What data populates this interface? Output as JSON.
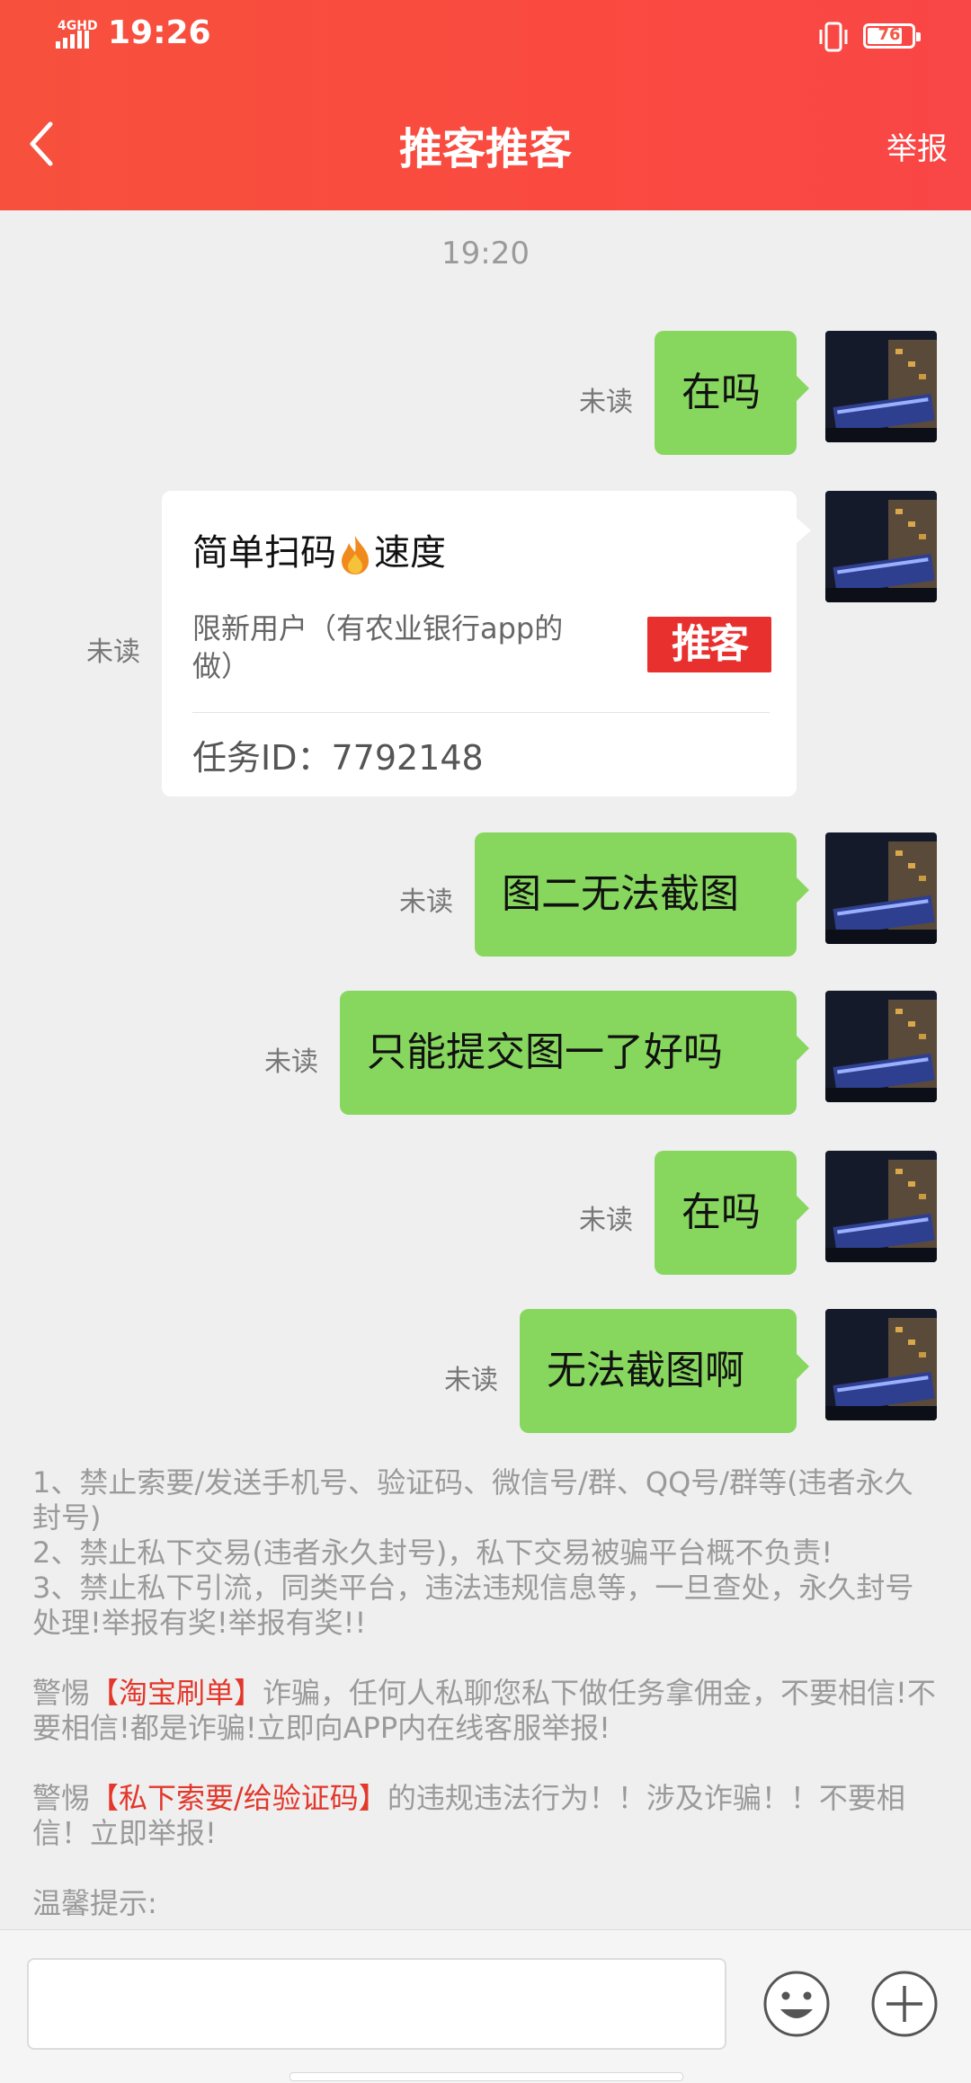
{
  "status_bar": {
    "network": "4GHD",
    "time": "19:26",
    "battery": "76",
    "vibrate_icon": "vibrate-icon"
  },
  "header": {
    "title": "推客推客",
    "report_label": "举报",
    "back_icon": "chevron-left-icon",
    "bg_color": "#f94a40"
  },
  "chat": {
    "time_label": "19:20",
    "unread_label": "未读",
    "bubble_color": "#87d75f",
    "messages": [
      {
        "text": "在吗",
        "status": "未读"
      },
      {
        "text": "图二无法截图",
        "status": "未读"
      },
      {
        "text": "只能提交图一了好吗",
        "status": "未读"
      },
      {
        "text": "在吗",
        "status": "未读"
      },
      {
        "text": "无法截图啊",
        "status": "未读"
      }
    ],
    "task_card": {
      "status": "未读",
      "title_before": "简单扫码",
      "title_after": "速度",
      "description": "限新用户（有农业银行app的做）",
      "logo_text": "推客",
      "task_id": "任务ID：7792148"
    }
  },
  "notice": {
    "lines": [
      "1、禁止索要/发送手机号、验证码、微信号/群、QQ号/群等(违者永久封号)",
      "2、禁止私下交易(违者永久封号)，私下交易被骗平台概不负责!",
      "3、禁止私下引流，同类平台，违法违规信息等，一旦查处，永久封号处理!举报有奖!举报有奖!!"
    ],
    "warn1_prefix": "警惕",
    "warn1_highlight": "【淘宝刷单】",
    "warn1_suffix": "诈骗，任何人私聊您私下做任务拿佣金，不要相信!不要相信!都是诈骗!立即向APP内在线客服举报!",
    "warn2_prefix": "警惕",
    "warn2_highlight": "【私下索要/给验证码】",
    "warn2_suffix": "的违规违法行为！！涉及诈骗！！不要相信！立即举报!",
    "tip": "温馨提示:"
  },
  "input_bar": {
    "placeholder": "",
    "emoji_icon": "smiley-icon",
    "plus_icon": "plus-circle-icon"
  }
}
